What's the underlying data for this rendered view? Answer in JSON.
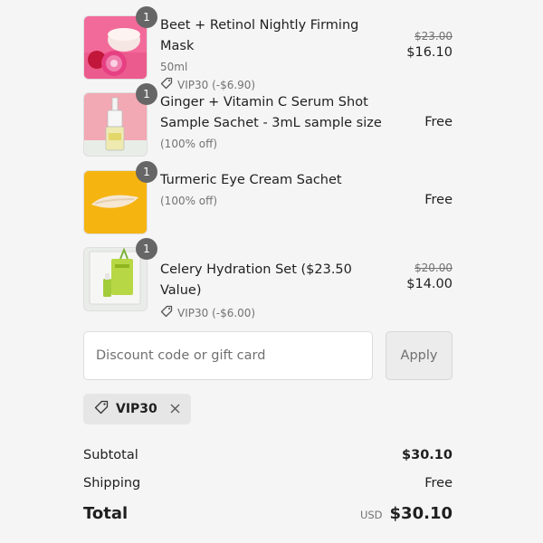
{
  "items": [
    {
      "name": "Beet + Retinol Nightly Firming Mask",
      "quantity": "1",
      "size": "50ml",
      "discount": "VIP30 (-$6.90)",
      "original_price": "$23.00",
      "price": "$16.10"
    },
    {
      "name": "Ginger + Vitamin C Serum Shot Sample Sachet - 3mL sample size",
      "quantity": "1",
      "discount_note": "(100% off)",
      "price": "Free"
    },
    {
      "name": "Turmeric Eye Cream Sachet",
      "quantity": "1",
      "discount_note": "(100% off)",
      "price": "Free"
    },
    {
      "name": "Celery Hydration Set ($23.50 Value)",
      "quantity": "1",
      "discount": "VIP30 (-$6.00)",
      "original_price": "$20.00",
      "price": "$14.00"
    }
  ],
  "discount_form": {
    "placeholder": "Discount code or gift card",
    "apply_label": "Apply"
  },
  "applied_code": "VIP30",
  "summary": {
    "subtotal_label": "Subtotal",
    "subtotal_value": "$30.10",
    "shipping_label": "Shipping",
    "shipping_value": "Free",
    "total_label": "Total",
    "currency": "USD",
    "total_value": "$30.10"
  },
  "colors": {
    "background": "#f5f5f5",
    "text": "#1f1f1f",
    "muted": "#737373",
    "badge": "#666666"
  }
}
